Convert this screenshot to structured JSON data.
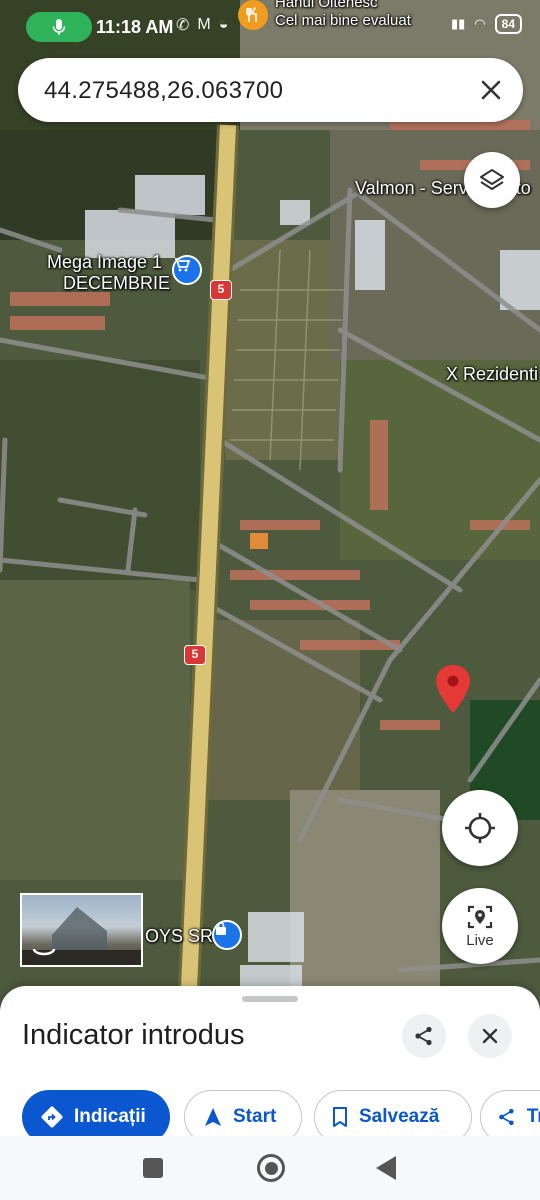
{
  "status_bar": {
    "time": "11:18 AM",
    "battery": "84",
    "notification_title": "Hanul Oltenesc",
    "notification_sub": "Cel mai bine evaluat"
  },
  "search": {
    "value": "44.275488,26.063700"
  },
  "map_labels": {
    "mega_image_line1": "Mega Image 1",
    "mega_image_line2": "DECEMBRIE",
    "valmon": "Valmon - Service auto",
    "rezidenti": "X Rezidenti",
    "toys_srl": "OYS SRL",
    "road_number": "5"
  },
  "buttons": {
    "live_label": "Live"
  },
  "sheet": {
    "title": "Indicator introdus",
    "actions": [
      {
        "label": "Indicații"
      },
      {
        "label": "Start"
      },
      {
        "label": "Salvează"
      },
      {
        "label": "Trimite"
      }
    ]
  },
  "colors": {
    "accent": "#0b57d0",
    "pin": "#e53935",
    "road": "#d9c476",
    "status_green": "#2fb35a"
  }
}
